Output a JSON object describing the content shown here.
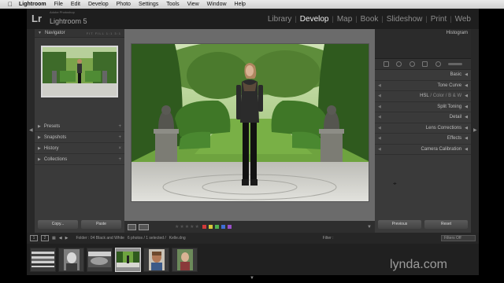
{
  "menubar": {
    "apple": "",
    "app": "Lightroom",
    "items": [
      "File",
      "Edit",
      "Develop",
      "Photo",
      "Settings",
      "Tools",
      "View",
      "Window",
      "Help"
    ]
  },
  "identity": {
    "logo": "Lr",
    "small": "Adobe Photoshop",
    "name": "Lightroom 5"
  },
  "modules": [
    "Library",
    "Develop",
    "Map",
    "Book",
    "Slideshow",
    "Print",
    "Web"
  ],
  "active_module": "Develop",
  "left_panel": {
    "navigator": {
      "title": "Navigator",
      "zoom": "FIT  FILL  1:1  3:1"
    },
    "sections": [
      "Presets",
      "Snapshots",
      "History",
      "Collections"
    ],
    "copy_label": "Copy...",
    "paste_label": "Paste"
  },
  "right_panel": {
    "histogram_title": "Histogram",
    "sections": [
      "Basic",
      "Tone Curve",
      "Split Toning",
      "Detail",
      "Lens Corrections",
      "Effects",
      "Camera Calibration"
    ],
    "hsl": {
      "a": "HSL",
      "b": "Color",
      "c": "B & W"
    },
    "previous_label": "Previous",
    "reset_label": "Reset"
  },
  "filmstrip_bar": {
    "page1": "1",
    "page2": "2",
    "source": "Folder : 04 Black and White",
    "count": "6 photos / 1 selected /",
    "filename": "Kelle.dng",
    "filter_label": "Filter :",
    "filter_value": "Filters Off"
  },
  "watermark": "lynda.com",
  "colors": {
    "active": "#f0f0f0",
    "label_red": "#d13a3a",
    "label_yellow": "#d8c63a",
    "label_green": "#4fb04f",
    "label_blue": "#3f6fd6",
    "label_purple": "#9a4fc8"
  }
}
